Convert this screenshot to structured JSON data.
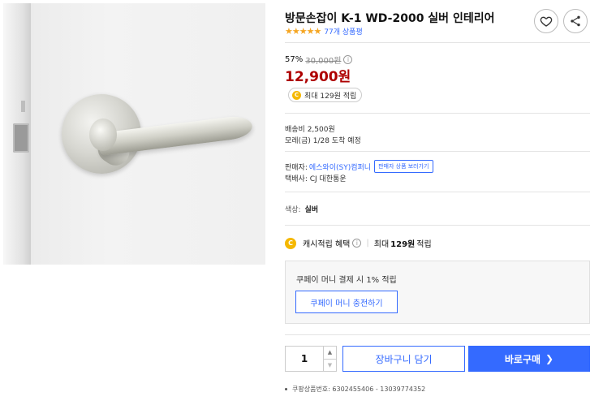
{
  "product": {
    "title": "방문손잡이 K-1 WD-2000 실버 인테리어",
    "stars": "★★★★★",
    "review_count": "77개 상품평",
    "discount_rate": "57%",
    "original_price": "30,000원",
    "sale_price": "12,900원",
    "reward_badge": "최대 129원 적립"
  },
  "icons": {
    "heart": "heart-icon",
    "share": "share-icon",
    "info": "info-icon",
    "coin": "coin-icon"
  },
  "shipping": {
    "fee": "배송비 2,500원",
    "arrival": "모레(금) 1/28 도착 예정"
  },
  "seller": {
    "label": "판매자:",
    "name": "에스와이(SY)컴퍼니",
    "link": "판매자 상품 보러가기",
    "courier": "택배사: CJ 대한통운"
  },
  "option": {
    "label": "색상:",
    "value": "실버"
  },
  "cash_reward": {
    "coin": "C",
    "label": "캐시적립 혜택",
    "info": "i",
    "separator": "|",
    "prefix": "최대",
    "amount": "129원",
    "suffix": "적립"
  },
  "coupay_money": {
    "text": "쿠페이 머니 결제 시 1% 적립",
    "charge_button": "쿠페이 머니 충전하기"
  },
  "purchase": {
    "quantity": "1",
    "up_arrow": "▲",
    "down_arrow": "▼",
    "cart_button": "장바구니 담기",
    "buy_button": "바로구매",
    "buy_chevron": "❯"
  },
  "product_number": "쿠팡상품번호: 6302455406 - 13039774352",
  "colors": {
    "accent": "#346aff",
    "price": "#ae0000",
    "star": "#f5a623",
    "coin": "#f5b800"
  }
}
